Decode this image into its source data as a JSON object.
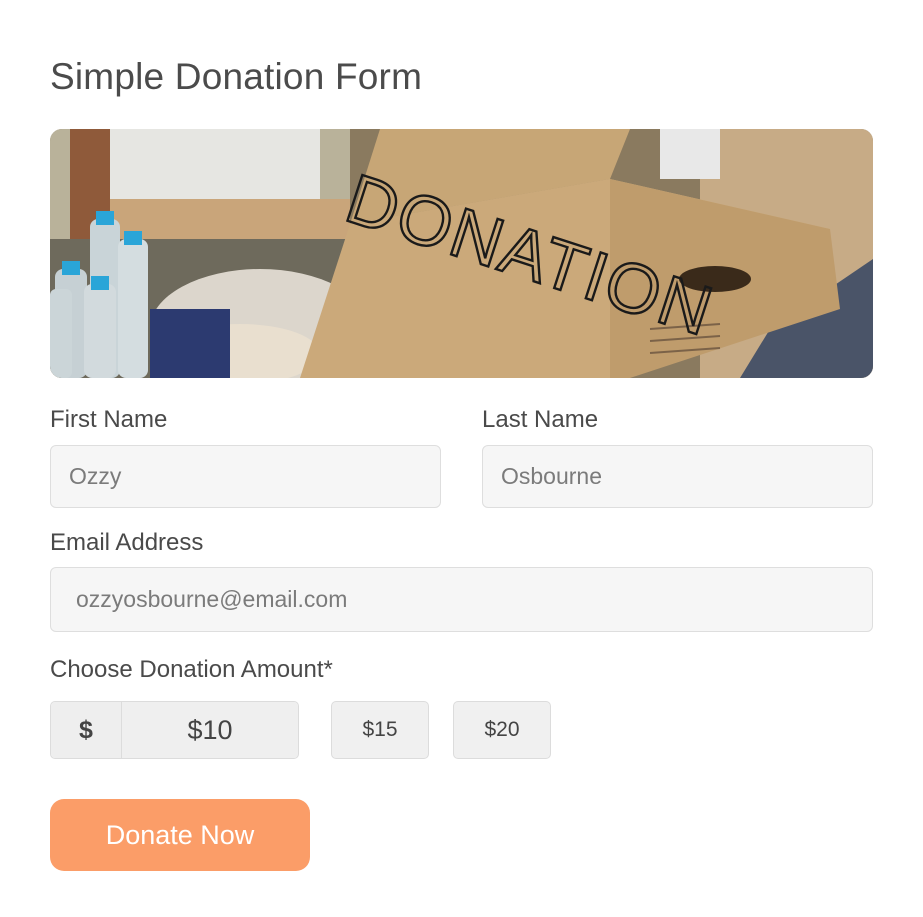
{
  "form": {
    "title": "Simple Donation Form",
    "hero_image": {
      "box_text": "DONATION"
    },
    "first_name": {
      "label": "First Name",
      "value": "Ozzy"
    },
    "last_name": {
      "label": "Last Name",
      "value": "Osbourne"
    },
    "email": {
      "label": "Email Address",
      "value": "ozzyosbourne@email.com"
    },
    "donation": {
      "label": "Choose Donation Amount*",
      "currency_symbol": "$",
      "custom_value": "$10",
      "options": [
        "$15",
        "$20"
      ]
    },
    "submit_label": "Donate Now"
  },
  "colors": {
    "accent": "#fb9d68",
    "field_bg": "#f6f6f6",
    "field_border": "#dedede"
  }
}
